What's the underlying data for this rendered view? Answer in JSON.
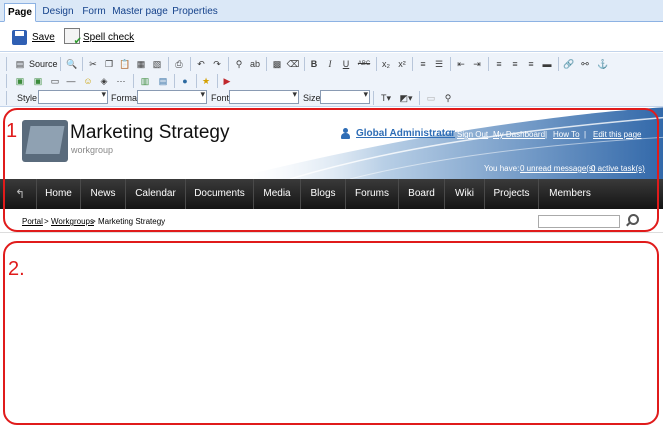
{
  "tabs": [
    {
      "label": "Page",
      "active": true
    },
    {
      "label": "Design",
      "active": false
    },
    {
      "label": "Form",
      "active": false
    },
    {
      "label": "Master page",
      "active": false
    },
    {
      "label": "Properties",
      "active": false
    }
  ],
  "actions": {
    "save_label": "Save",
    "spell_label": "Spell check"
  },
  "editor_toolbar": {
    "source_label": "Source",
    "style_label": "Style",
    "format_label": "Format",
    "font_label": "Font",
    "size_label": "Size",
    "bold": "B",
    "italic": "I",
    "underline": "U",
    "strike": "ABC",
    "subscript": "x₂",
    "superscript": "x²"
  },
  "header": {
    "title": "Marketing Strategy",
    "subtitle": "workgroup",
    "user": "Global Administrator",
    "user_colon": ":",
    "links": [
      "Sign Out",
      "My Dashboard",
      "How To",
      "Edit this page"
    ],
    "separator": "|",
    "messages_prefix": "You have:",
    "unread_messages": "0 unread message(s)",
    "active_tasks": "0 active task(s)"
  },
  "nav": [
    "Home",
    "News",
    "Calendar",
    "Documents",
    "Media",
    "Blogs",
    "Forums",
    "Board",
    "Wiki",
    "Projects",
    "Members"
  ],
  "breadcrumb": {
    "portal": "Portal",
    "sep": ">",
    "workgroups": "Workgroups",
    "current": "Marketing Strategy"
  },
  "zones": {
    "zone1": "1",
    "zone2": "2."
  },
  "colors": {
    "zone_outline": "#e01b1b",
    "link_blue": "#2e6db6",
    "nav_bg": "#1e1e1e"
  }
}
